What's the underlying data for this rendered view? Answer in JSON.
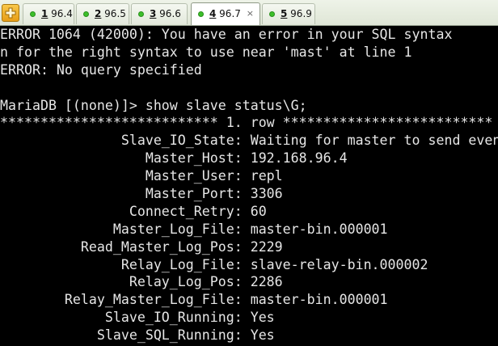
{
  "tabs": [
    {
      "num": "1",
      "label": " 96.4"
    },
    {
      "num": "2",
      "label": " 96.5"
    },
    {
      "num": "3",
      "label": " 96.6"
    },
    {
      "num": "4",
      "label": " 96.7"
    },
    {
      "num": "5",
      "label": " 96.9"
    }
  ],
  "active_tab_close": "×",
  "terminal": {
    "lines": [
      "ERROR 1064 (42000): You have an error in your SQL syntax",
      "n for the right syntax to use near 'mast' at line 1",
      "ERROR: No query specified",
      "",
      "MariaDB [(none)]> show slave status\\G;",
      "*************************** 1. row **************************",
      "               Slave_IO_State: Waiting for master to send event",
      "                  Master_Host: 192.168.96.4",
      "                  Master_User: repl",
      "                  Master_Port: 3306",
      "                Connect_Retry: 60",
      "              Master_Log_File: master-bin.000001",
      "          Read_Master_Log_Pos: 2229",
      "               Relay_Log_File: slave-relay-bin.000002",
      "                Relay_Log_Pos: 2286",
      "        Relay_Master_Log_File: master-bin.000001",
      "             Slave_IO_Running: Yes",
      "            Slave_SQL_Running: Yes"
    ]
  }
}
